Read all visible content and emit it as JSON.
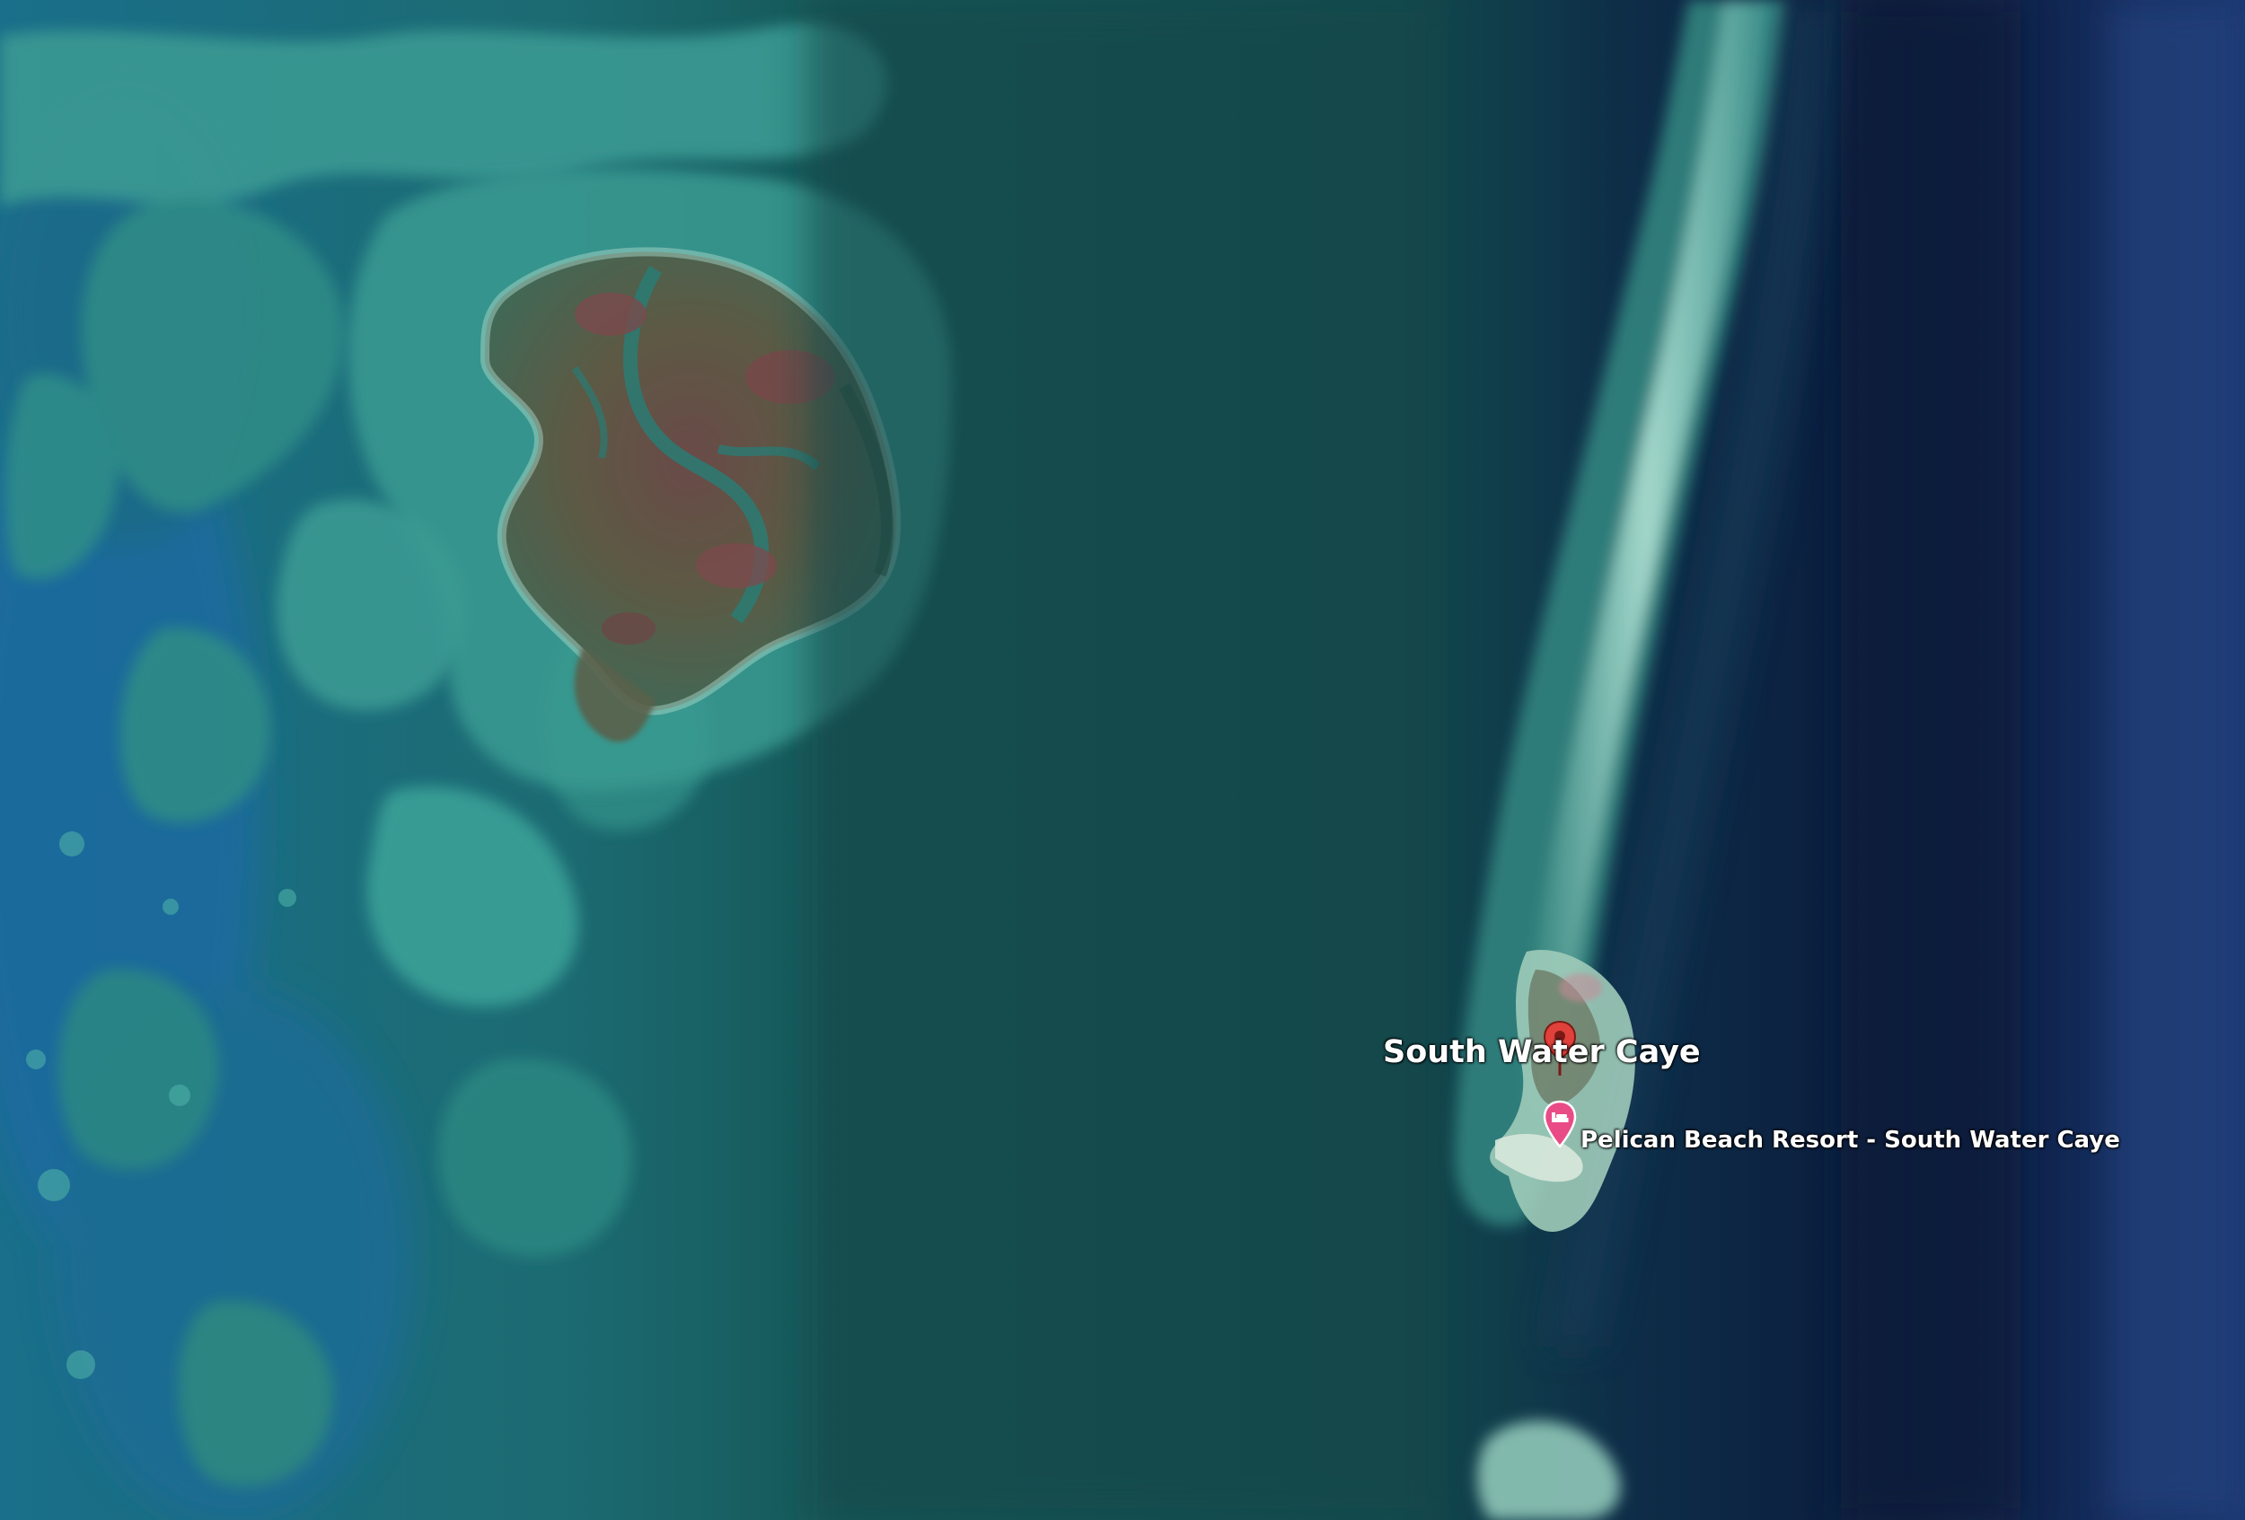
{
  "map": {
    "view": "satellite",
    "colors": {
      "deep_ocean": "#0a1f3f",
      "reef_teal": "#1f7f86",
      "lagoon": "#1a5a5c",
      "shallow_sand": "#9fd4c9",
      "island_land": "#5b5a45",
      "pin_red": "#e0413a",
      "pin_pink": "#e94b86"
    },
    "labels": {
      "primary_place": "South Water Caye",
      "hotel_place": "Pelican Beach Resort - South Water Caye"
    },
    "icons": {
      "primary_marker": "red-map-pin-icon",
      "hotel_marker": "hotel-bed-pin-icon"
    }
  }
}
